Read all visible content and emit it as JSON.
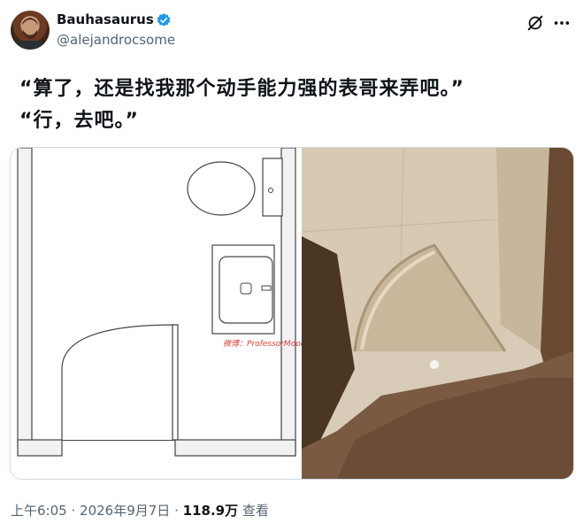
{
  "author": {
    "name": "Bauhasaurus",
    "handle": "@alejandrocsome",
    "verified": true
  },
  "tweet": {
    "text": "“算了，还是找我那个动手能力强的表哥来弄吧。”\n“行，去吧。”"
  },
  "media": {
    "watermark": "微博：ProfessorMoody"
  },
  "meta": {
    "time": "上午6:05",
    "dot1": "·",
    "date": "2026年9月7日",
    "dot2": "·",
    "views": "118.9万",
    "views_label": "查看"
  },
  "icons": {
    "verified": "verified-badge-icon",
    "grok": "grok-icon",
    "more": "more-options-icon"
  },
  "colors": {
    "verified_blue": "#1d9bf0",
    "secondary_text": "#536471"
  }
}
